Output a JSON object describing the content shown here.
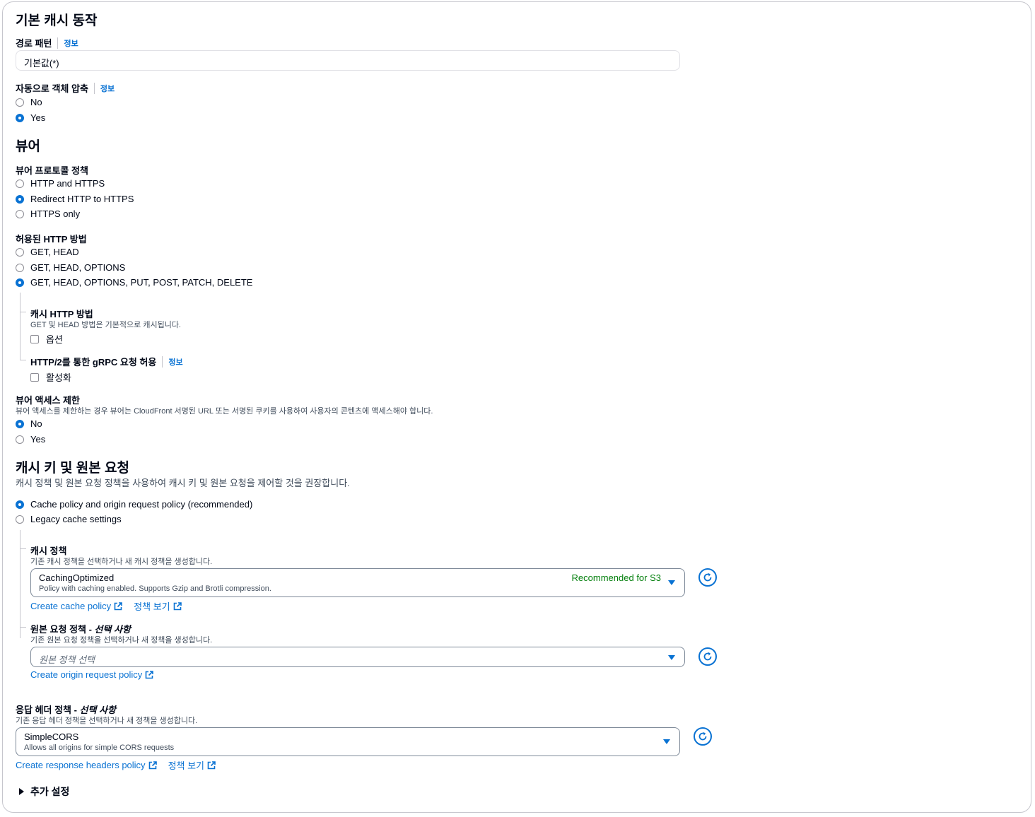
{
  "sections": {
    "default_behavior": "기본 캐시 동작",
    "viewer": "뷰어",
    "cache_key": "캐시 키 및 원본 요청"
  },
  "info_label": "정보",
  "path_pattern": {
    "label": "경로 패턴",
    "value": "기본값(*)"
  },
  "compress": {
    "label": "자동으로 객체 압축",
    "options": [
      "No",
      "Yes"
    ],
    "selected": "Yes"
  },
  "viewer_protocol": {
    "label": "뷰어 프로토콜 정책",
    "options": [
      "HTTP and HTTPS",
      "Redirect HTTP to HTTPS",
      "HTTPS only"
    ],
    "selected": "Redirect HTTP to HTTPS"
  },
  "http_methods": {
    "label": "허용된 HTTP 방법",
    "options": [
      "GET, HEAD",
      "GET, HEAD, OPTIONS",
      "GET, HEAD, OPTIONS, PUT, POST, PATCH, DELETE"
    ],
    "selected": "GET, HEAD, OPTIONS, PUT, POST, PATCH, DELETE"
  },
  "cache_http": {
    "label": "캐시 HTTP 방법",
    "desc": "GET 및 HEAD 방법은 기본적으로 캐시됩니다.",
    "checkbox": "옵션"
  },
  "grpc": {
    "label": "HTTP/2를 통한 gRPC 요청 허용",
    "checkbox": "활성화"
  },
  "restrict": {
    "label": "뷰어 액세스 제한",
    "desc": "뷰어 액세스를 제한하는 경우 뷰어는 CloudFront 서명된 URL 또는 서명된 쿠키를 사용하여 사용자의 콘텐츠에 액세스해야 합니다.",
    "options": [
      "No",
      "Yes"
    ],
    "selected": "No"
  },
  "cache_key": {
    "desc": "캐시 정책 및 원본 요청 정책을 사용하여 캐시 키 및 원본 요청을 제어할 것을 권장합니다.",
    "options": [
      "Cache policy and origin request policy (recommended)",
      "Legacy cache settings"
    ],
    "selected": "Cache policy and origin request policy (recommended)"
  },
  "cache_policy": {
    "label": "캐시 정책",
    "desc": "기존 캐시 정책을 선택하거나 새 캐시 정책을 생성합니다.",
    "value": "CachingOptimized",
    "value_desc": "Policy with caching enabled. Supports Gzip and Brotli compression.",
    "tag": "Recommended for S3",
    "create_link": "Create cache policy",
    "view_link": "정책 보기"
  },
  "origin_policy": {
    "label": "원본 요청 정책 - ",
    "label_optional": "선택 사항",
    "desc": "기존 원본 요청 정책을 선택하거나 새 정책을 생성합니다.",
    "placeholder": "원본 정책 선택",
    "create_link": "Create origin request policy"
  },
  "response_policy": {
    "label": "응답 헤더 정책 - ",
    "label_optional": "선택 사항",
    "desc": "기존 응답 헤더 정책을 선택하거나 새 정책을 생성합니다.",
    "value": "SimpleCORS",
    "value_desc": "Allows all origins for simple CORS requests",
    "create_link": "Create response headers policy",
    "view_link": "정책 보기"
  },
  "additional": "추가 설정",
  "colors": {
    "accent": "#0972d3",
    "success": "#037f0c"
  },
  "icons": [
    "radio",
    "checkbox",
    "external-link-icon",
    "refresh-icon",
    "caret-down-icon",
    "caret-right-icon"
  ]
}
